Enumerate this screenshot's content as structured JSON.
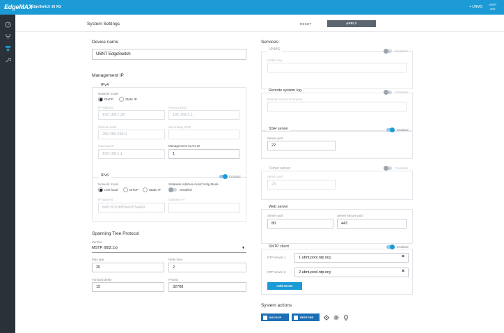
{
  "topbar": {
    "brand": "EdgeMAX",
    "device": "EdgeSwitch 16 XG",
    "unms_link": "+ UNMS",
    "user_label": "USER",
    "user_name": "ubnt"
  },
  "header": {
    "title": "System Settings",
    "reset": "RESET",
    "apply": "APPLY"
  },
  "device_name": {
    "title": "Device name",
    "value": "UBNT EdgeSwitch"
  },
  "management_ip": {
    "title": "Management IP",
    "ipv4": {
      "title": "IPv4",
      "network_mode_label": "Network mode",
      "mode_dhcp": "DHCP",
      "mode_static": "Static IP",
      "ip_label": "IP Address",
      "ip": "192.168.1.38",
      "primary_dns_label": "Primary DNS",
      "primary_dns": "192.168.1.1",
      "subnet_label": "Subnet mask",
      "subnet": "255.255.255.0",
      "secondary_dns_label": "Secondary DNS",
      "secondary_dns": "",
      "gateway_label": "Gateway IP",
      "gateway": "192.168.1.1",
      "vlan_label": "Management VLAN ID",
      "vlan": "1"
    },
    "ipv6": {
      "title": "IPv6",
      "enabled_label": "Enabled",
      "network_mode_label": "Network mode",
      "mode_link_local": "Link-local",
      "mode_dhcp": "DHCP",
      "mode_static": "Static IP",
      "slaac_label": "Stateless Address AutoConfig Mode",
      "slaac_state": "Disabled",
      "ip_label": "IP address",
      "ip": "fe80::618:d6ff:fea0:57aa/64",
      "gateway_label": "Gateway IP",
      "gateway": ""
    }
  },
  "stp": {
    "title": "Spanning Tree Protocol",
    "version_label": "Version",
    "version": "MSTP (802.1s)",
    "max_age_label": "Max age",
    "max_age": "20",
    "hello_label": "Hello time",
    "hello": "2",
    "fwd_delay_label": "Forward delay",
    "fwd_delay": "15",
    "priority_label": "Priority",
    "priority": "32768"
  },
  "services": {
    "title": "Services",
    "unms": {
      "title": "UNMS",
      "state": "Disabled",
      "key_label": "UNMS key",
      "key": ""
    },
    "syslog": {
      "title": "Remote system log",
      "state": "Disabled",
      "host_label": "Remote server hostname",
      "host": ""
    },
    "ssh": {
      "title": "SSH server",
      "state": "Enabled",
      "port_label": "Server port",
      "port": "22"
    },
    "telnet": {
      "title": "Telnet server",
      "state": "Disabled",
      "port_label": "Server port",
      "port": "23"
    },
    "web": {
      "title": "Web server",
      "port_label": "Server port",
      "port": "80",
      "secure_label": "Server secure port",
      "secure_port": "443"
    },
    "sntp": {
      "title": "SNTP client",
      "state": "Enabled",
      "server1_label": "NTP server 1",
      "server1": "1.ubnt.pool.ntp.org",
      "server2_label": "NTP server 2",
      "server2": "2.ubnt.pool.ntp.org",
      "add_server": "Add server"
    }
  },
  "system_actions": {
    "title": "System actions",
    "backup": "BACKUP",
    "restore": "RESTORE"
  },
  "colors": {
    "accent": "#1c9ad6",
    "sidebar": "#2b3138",
    "apply_button": "#5c6670"
  },
  "icons": [
    "dashboard-icon",
    "ports-icon",
    "vlan-icon",
    "tools-icon",
    "locate-icon",
    "settings-icon",
    "lightbulb-icon"
  ]
}
